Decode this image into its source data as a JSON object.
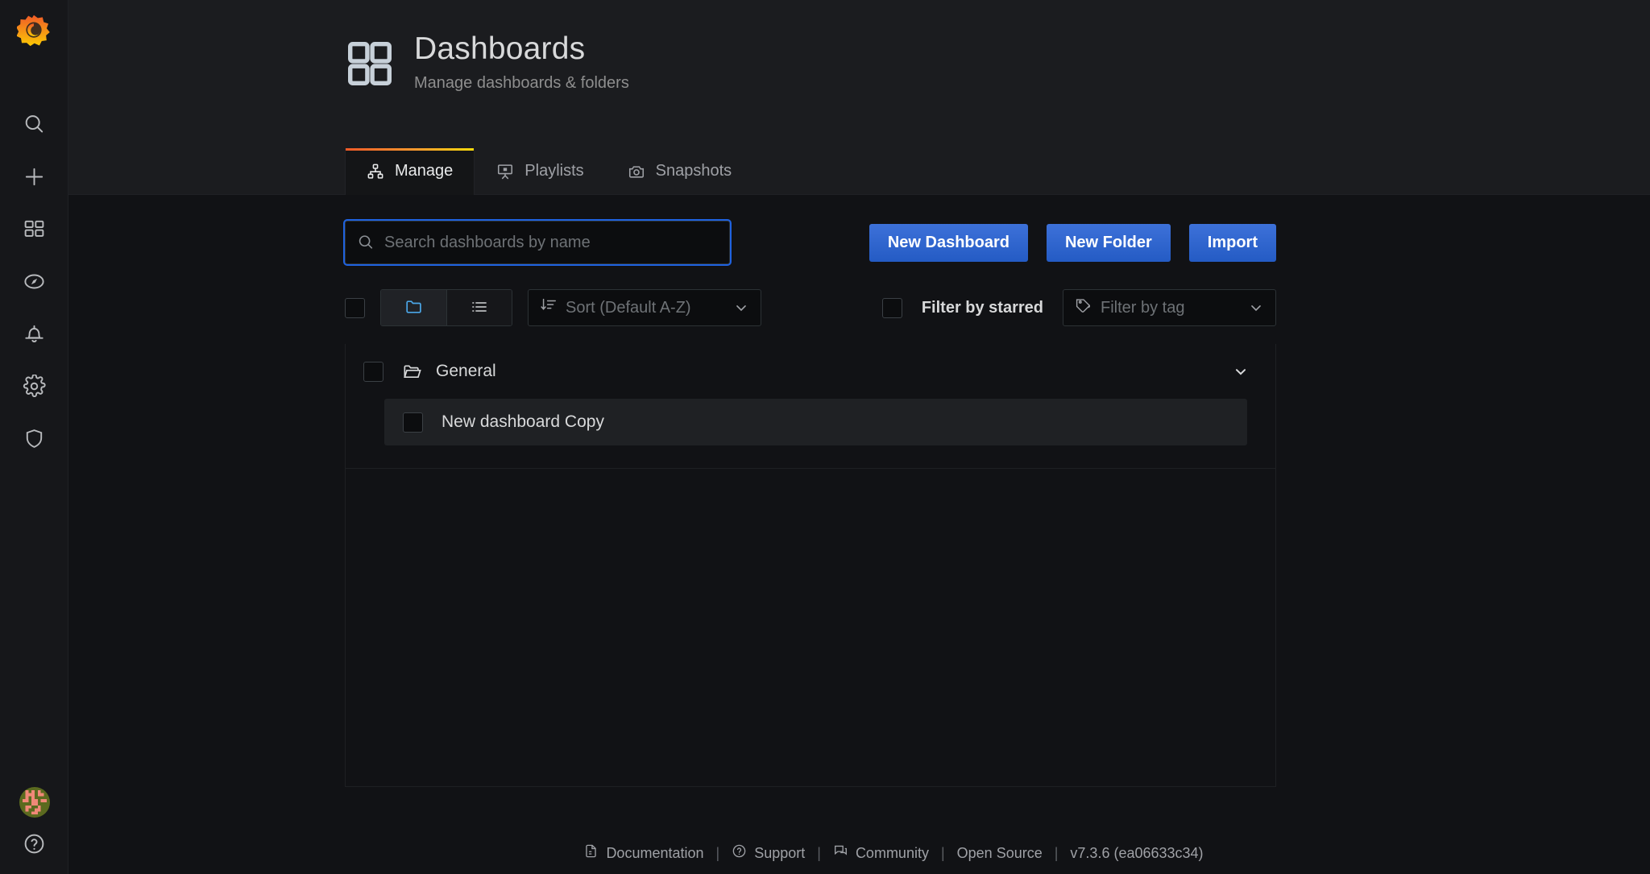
{
  "sidebar": {
    "logo": {
      "name": "grafana-logo",
      "color": "#f5732a"
    },
    "items": [
      {
        "id": "search",
        "icon": "search-icon",
        "label": "Search"
      },
      {
        "id": "create",
        "icon": "plus-icon",
        "label": "Create"
      },
      {
        "id": "dashboards",
        "icon": "dashboards-grid-icon",
        "label": "Dashboards"
      },
      {
        "id": "explore",
        "icon": "compass-icon",
        "label": "Explore"
      },
      {
        "id": "alerting",
        "icon": "bell-icon",
        "label": "Alerting"
      },
      {
        "id": "configuration",
        "icon": "gear-icon",
        "label": "Configuration"
      },
      {
        "id": "server-admin",
        "icon": "shield-icon",
        "label": "Server Admin"
      }
    ],
    "bottom": [
      {
        "id": "profile",
        "icon": "avatar",
        "label": "User profile"
      },
      {
        "id": "help",
        "icon": "question-circle-icon",
        "label": "Help"
      }
    ]
  },
  "header": {
    "icon": "apps-grid-icon",
    "title": "Dashboards",
    "subtitle": "Manage dashboards & folders"
  },
  "tabs": [
    {
      "id": "manage",
      "label": "Manage",
      "icon": "sitemap-icon",
      "active": true
    },
    {
      "id": "playlists",
      "label": "Playlists",
      "icon": "presentation-icon",
      "active": false
    },
    {
      "id": "snapshots",
      "label": "Snapshots",
      "icon": "camera-icon",
      "active": false
    }
  ],
  "search": {
    "icon": "search-icon",
    "value": "",
    "placeholder": "Search dashboards by name",
    "focused": true
  },
  "actions": {
    "new_dashboard": "New Dashboard",
    "new_folder": "New Folder",
    "import": "Import"
  },
  "toolbar": {
    "select_all_checkbox": {
      "checked": false
    },
    "view_toggle": [
      {
        "id": "folder-view",
        "icon": "folder-icon",
        "active": true
      },
      {
        "id": "list-view",
        "icon": "list-icon",
        "active": false
      }
    ],
    "sort": {
      "icon": "sort-amount-down-icon",
      "value": "Sort (Default A-Z)",
      "chevron": "chevron-down-icon"
    },
    "filter_starred": {
      "label": "Filter by starred",
      "checked": false
    },
    "filter_tag": {
      "icon": "tag-icon",
      "placeholder": "Filter by tag",
      "value": "",
      "chevron": "chevron-down-icon"
    }
  },
  "results": {
    "folders": [
      {
        "name": "General",
        "icon": "folder-open-icon",
        "checkbox": {
          "checked": false
        },
        "chevron": "chevron-down-icon",
        "expanded": true,
        "dashboards": [
          {
            "title": "New dashboard Copy",
            "checkbox": {
              "checked": false
            },
            "highlighted": true
          }
        ]
      }
    ]
  },
  "footer": {
    "links": [
      {
        "id": "documentation",
        "label": "Documentation",
        "icon": "document-icon"
      },
      {
        "id": "support",
        "label": "Support",
        "icon": "question-circle-icon"
      },
      {
        "id": "community",
        "label": "Community",
        "icon": "comments-icon"
      },
      {
        "id": "open-source",
        "label": "Open Source",
        "icon": "none"
      }
    ],
    "separator": "|",
    "version": "v7.3.6 (ea06633c34)"
  },
  "theme": {
    "accent_blue": "#3274d9",
    "focus_blue": "#1f62e0",
    "panel_bg": "#111215",
    "header_bg": "#1b1c1f",
    "text_primary": "#d8d9da",
    "text_secondary": "#9fa1a6",
    "orange": "#f05a28",
    "yellow": "#fada0b"
  }
}
